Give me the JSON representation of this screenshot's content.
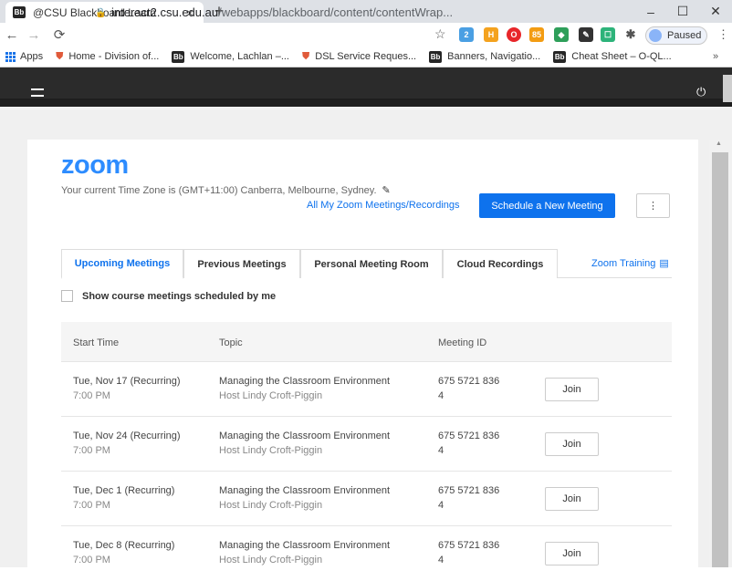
{
  "browser": {
    "tab_title": "@CSU Blackboard Learn",
    "tab_icon": "Bb",
    "url_host": "interact2.csu.edu.au",
    "url_path": "/webapps/blackboard/content/contentWrap...",
    "profile_label": "Paused",
    "bookmarks": [
      {
        "label": "Apps",
        "icon": "apps-icon"
      },
      {
        "label": "Home - Division of...",
        "icon": "shield-icon"
      },
      {
        "label": "Welcome, Lachlan –...",
        "icon": "Bb"
      },
      {
        "label": "DSL Service Reques...",
        "icon": "shield-icon"
      },
      {
        "label": "Banners, Navigatio...",
        "icon": "Bb"
      },
      {
        "label": "Cheat Sheet – O-QL...",
        "icon": "Bb"
      }
    ],
    "bookmarks_overflow": "»"
  },
  "zoom": {
    "logo": "zoom",
    "timezone_text": "Your current Time Zone is (GMT+11:00) Canberra, Melbourne, Sydney.",
    "all_link": "All My Zoom Meetings/Recordings",
    "schedule_button": "Schedule a New Meeting",
    "more_button": "⋮",
    "tabs": [
      {
        "label": "Upcoming Meetings",
        "active": true
      },
      {
        "label": "Previous Meetings",
        "active": false
      },
      {
        "label": "Personal Meeting Room",
        "active": false
      },
      {
        "label": "Cloud Recordings",
        "active": false
      }
    ],
    "training_link": "Zoom Training",
    "checkbox_label": "Show course meetings scheduled by me",
    "columns": [
      "Start Time",
      "Topic",
      "Meeting ID"
    ],
    "meetings": [
      {
        "date": "Tue, Nov 17 (Recurring)",
        "time": "7:00 PM",
        "topic": "Managing the Classroom Environment",
        "host": "Host Lindy Croft-Piggin",
        "id_line1": "675 5721 836",
        "id_line2": "4",
        "join": "Join"
      },
      {
        "date": "Tue, Nov 24 (Recurring)",
        "time": "7:00 PM",
        "topic": "Managing the Classroom Environment",
        "host": "Host Lindy Croft-Piggin",
        "id_line1": "675 5721 836",
        "id_line2": "4",
        "join": "Join"
      },
      {
        "date": "Tue, Dec 1 (Recurring)",
        "time": "7:00 PM",
        "topic": "Managing the Classroom Environment",
        "host": "Host Lindy Croft-Piggin",
        "id_line1": "675 5721 836",
        "id_line2": "4",
        "join": "Join"
      },
      {
        "date": "Tue, Dec 8 (Recurring)",
        "time": "7:00 PM",
        "topic": "Managing the Classroom Environment",
        "host": "Host Lindy Croft-Piggin",
        "id_line1": "675 5721 836",
        "id_line2": "4",
        "join": "Join"
      }
    ]
  },
  "colors": {
    "accent": "#0e72ed",
    "zoom_blue": "#2d8cff",
    "bb_header": "#2b2b2b"
  }
}
